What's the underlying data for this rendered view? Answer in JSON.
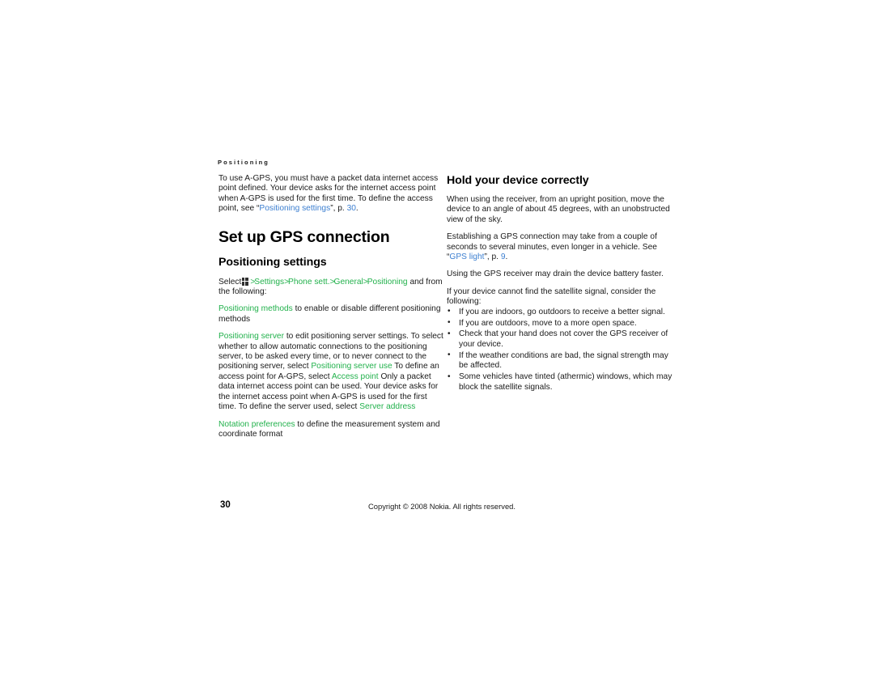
{
  "document": {
    "running_header": "Positioning",
    "page_number": "30",
    "copyright": "Copyright © 2008 Nokia. All rights reserved.",
    "colors": {
      "ui_element_green": "#22b14c",
      "cross_reference_blue": "#3c7fd0",
      "body_text": "#1a1a1a",
      "background": "#ffffff"
    }
  },
  "left_column": {
    "intro_paragraph": {
      "part1": "To use A-GPS, you must have a packet data internet access point defined. Your device asks for the internet access point when A-GPS is used for the first time. To define the access point, see “",
      "xref_label": "Positioning settings",
      "part2": "”, p. ",
      "xref_page": "30",
      "part3": "."
    },
    "chapter_heading": "Set up GPS connection",
    "section_heading": "Positioning settings",
    "select_path": {
      "lead": "Select",
      "icon": "menu-grid-icon",
      "separator": ">",
      "items": [
        "Settings",
        "Phone sett.",
        "General",
        "Positioning"
      ],
      "trailing": "and from the following:"
    },
    "settings": [
      {
        "ui": "Positioning methods",
        "text": " to enable or disable different positioning methods"
      },
      {
        "ui": "Positioning server",
        "text": " to edit positioning server settings. To select whether to allow automatic connections to the positioning server, to be asked every time, or to never connect to the positioning server, select ",
        "ui2": "Positioning server use",
        "text2": " To define an access point for A-GPS, select ",
        "ui3": "Access point",
        "text3": " Only a packet data internet access point can be used. Your device asks for the internet access point when A-GPS is used for the first time. To define the server used, select ",
        "ui4": "Server address"
      },
      {
        "ui": "Notation preferences",
        "text": " to define the measurement system and coordinate format"
      }
    ]
  },
  "right_column": {
    "section_heading": "Hold your device correctly",
    "paragraph1": "When using the receiver, from an upright position, move the device to an angle of about 45 degrees, with an unobstructed view of the sky.",
    "paragraph2": {
      "part1": "Establishing a GPS connection may take from a couple of seconds to several minutes, even longer in a vehicle. See “",
      "xref_label": "GPS light",
      "part2": "”, p. ",
      "xref_page": "9",
      "part3": "."
    },
    "paragraph3": "Using the GPS receiver may drain the device battery faster.",
    "paragraph4": "If your device cannot find the satellite signal, consider the following:",
    "bullets": [
      "If you are indoors, go outdoors to receive a better signal.",
      "If you are outdoors, move to a more open space.",
      "Check that your hand does not cover the GPS receiver of your device.",
      "If the weather conditions are bad, the signal strength may be affected.",
      "Some vehicles have tinted (athermic) windows, which may block the satellite signals."
    ]
  }
}
